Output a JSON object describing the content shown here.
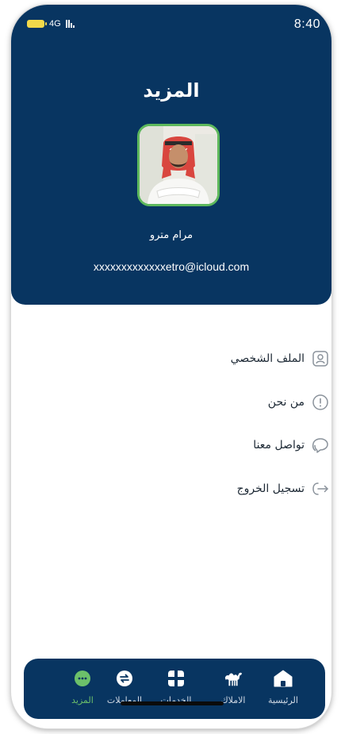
{
  "status_bar": {
    "time": "8:40",
    "network": "4G"
  },
  "header": {
    "title": "المزيد"
  },
  "profile": {
    "name": "مرام مترو",
    "email": "xxxxxxxxxxxxxetro@icloud.com"
  },
  "menu": {
    "items": [
      {
        "label": "الملف الشخصي",
        "icon": "user-icon"
      },
      {
        "label": "من نحن",
        "icon": "info-icon"
      },
      {
        "label": "تواصل معنا",
        "icon": "chat-icon"
      },
      {
        "label": "تسجيل الخروج",
        "icon": "logout-icon"
      }
    ]
  },
  "bottom_nav": {
    "items": [
      {
        "label": "الرئيسية",
        "icon": "home-icon"
      },
      {
        "label": "الاملاك",
        "icon": "camel-icon"
      },
      {
        "label": "الخدمات",
        "icon": "grid-icon"
      },
      {
        "label": "المعاملات",
        "icon": "exchange-icon"
      },
      {
        "label": "المزيد",
        "icon": "more-icon",
        "active": true
      }
    ]
  },
  "colors": {
    "primary": "#083561",
    "accent": "#5db85c",
    "text": "#1b2733"
  }
}
